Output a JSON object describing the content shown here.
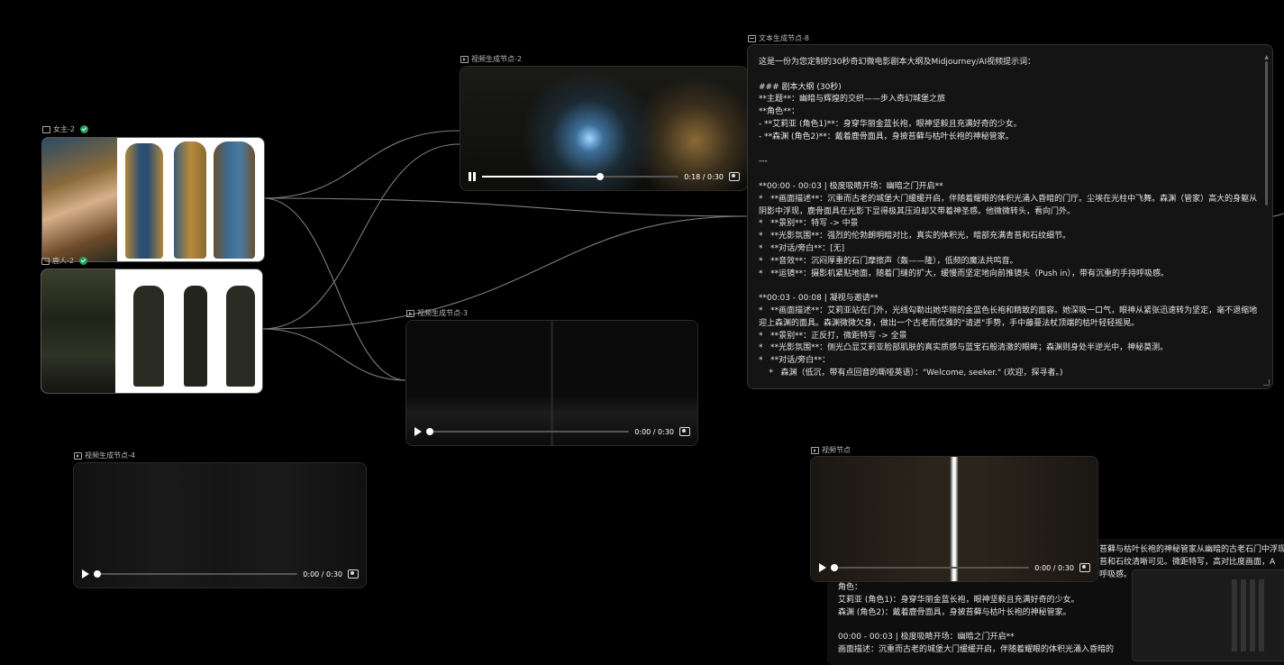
{
  "nodes": {
    "img1": {
      "title": "女主-2",
      "icon": "image-icon"
    },
    "img2": {
      "title": "鹿人-2",
      "icon": "image-icon"
    },
    "vid2": {
      "title": "视频生成节点-2",
      "time": "0:18 / 0:30",
      "progress": 0.6
    },
    "vid3": {
      "title": "视频生成节点-3",
      "time": "0:00 / 0:30",
      "progress": 0
    },
    "vid4": {
      "title": "视频生成节点-4",
      "time": "0:00 / 0:30",
      "progress": 0
    },
    "vidn": {
      "title": "视频节点",
      "time": "0:00 / 0:30",
      "progress": 0
    },
    "text8": {
      "title": "文本生成节点-8"
    }
  },
  "text_content": "这是一份为您定制的30秒奇幻微电影剧本大纲及Midjourney/AI视频提示词：\n\n### 剧本大纲 (30秒)\n**主题**：幽暗与辉煌的交织——步入奇幻城堡之旅\n**角色**：\n- **艾莉亚 (角色1)**：身穿华丽金蓝长袍，眼神坚毅且充满好奇的少女。\n- **森渊 (角色2)**：戴着鹿骨面具，身披苔藓与枯叶长袍的神秘管家。\n\n---\n\n**00:00 - 00:03 | 极度吸睛开场：幽暗之门开启**\n*   **画面描述**：沉重而古老的城堡大门缓缓开启，伴随着耀眼的体积光涌入昏暗的门厅。尘埃在光柱中飞舞。森渊（管家）高大的身躯从阴影中浮现，鹿骨面具在光影下显得极其压迫却又带着神圣感。他微微转头，看向门外。\n*   **景别**：特写 -> 中景\n*   **光影氛围**：强烈的伦勃朗明暗对比，真实的体积光，暗部充满青苔和石纹细节。\n*   **对话/旁白**：[无]\n*   **音效**：沉闷厚重的石门摩擦声（轰——隆），低频的魔法共鸣音。\n*   **运镜**：摄影机紧贴地面，随着门缝的扩大，缓慢而坚定地向前推镜头（Push in），带有沉重的手持呼吸感。\n\n**00:03 - 00:08 | 凝视与邀请**\n*   **画面描述**：艾莉亚站在门外，光线勾勒出她华丽的金蓝色长袍和精致的面容。她深吸一口气，眼神从紧张迅速转为坚定，毫不退缩地迎上森渊的面具。森渊微微欠身，做出一个古老而优雅的\"请进\"手势，手中藤蔓法杖顶端的枯叶轻轻摇晃。\n*   **景别**：正反打，微距特写 -> 全景\n*   **光影氛围**：侧光凸显艾莉亚脸部肌肤的真实质感与蓝宝石般清澈的眼眸；森渊则身处半逆光中，神秘莫测。\n*   **对话/旁白**：\n    *   森渊（低沉，带有点回音的嘶哑英语）：\"Welcome, seeker.\" (欢迎，探寻者。)",
  "preview": {
    "top_lines": "苔藓与枯叶长袍的神秘管家从幽暗的古老石门中浮现\n苔和石纹清晰可见。微距特写，高对比度画面，A\n呼吸感。",
    "lines": "角色：\n艾莉亚 (角色1)：身穿华丽金蓝长袍，眼神坚毅且充满好奇的少女。\n森渊 (角色2)：戴着鹿骨面具，身披苔藓与枯叶长袍的神秘管家。\n\n00:00 - 00:03 | 极度吸睛开场：幽暗之门开启**\n画面描述：沉重而古老的城堡大门缓缓开启，伴随着耀眼的体积光涌入昏暗的"
  },
  "colors": {
    "background": "#000000",
    "check": "#1fa35a",
    "edge": "#8a8a8a",
    "node_bg": "#141414"
  }
}
